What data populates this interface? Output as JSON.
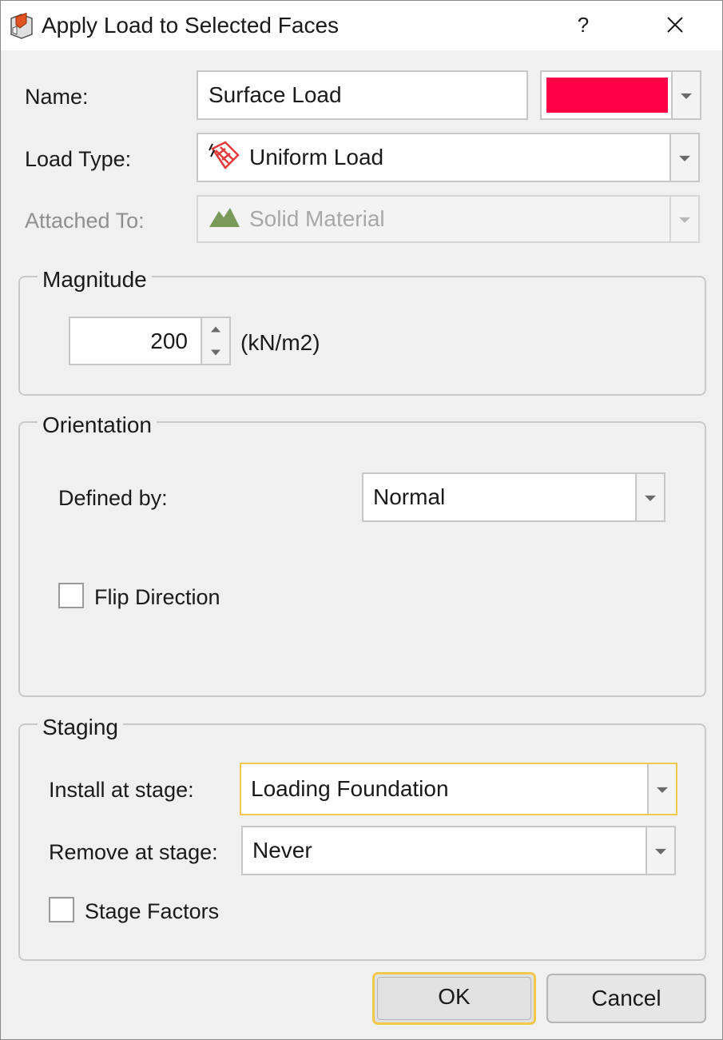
{
  "window": {
    "title": "Apply Load to Selected Faces",
    "help_label": "?"
  },
  "form": {
    "name_label": "Name:",
    "name_value": "Surface Load",
    "color": "#ff0048",
    "load_type_label": "Load Type:",
    "load_type_value": "Uniform Load",
    "load_type_icon": "uniform-load-icon",
    "attached_to_label": "Attached To:",
    "attached_to_value": "Solid Material",
    "attached_to_icon": "solid-material-icon"
  },
  "magnitude": {
    "title": "Magnitude",
    "value": "200",
    "unit": "(kN/m2)"
  },
  "orientation": {
    "title": "Orientation",
    "defined_by_label": "Defined by:",
    "defined_by_value": "Normal",
    "flip_label": "Flip Direction",
    "flip_checked": false
  },
  "staging": {
    "title": "Staging",
    "install_label": "Install at stage:",
    "install_value": "Loading Foundation",
    "remove_label": "Remove at stage:",
    "remove_value": "Never",
    "stage_factors_label": "Stage Factors",
    "stage_factors_checked": false
  },
  "buttons": {
    "ok": "OK",
    "cancel": "Cancel"
  },
  "colors": {
    "focus_accent": "#f2c84b",
    "uniform_load_icon": "#e23a3a",
    "solid_material_icon": "#7a9a5a"
  }
}
